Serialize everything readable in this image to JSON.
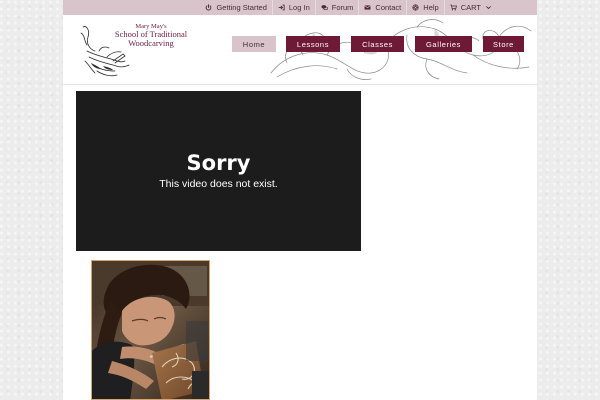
{
  "utility_nav": [
    {
      "label": "Getting Started",
      "icon": "power-icon"
    },
    {
      "label": "Log In",
      "icon": "login-icon"
    },
    {
      "label": "Forum",
      "icon": "chat-icon"
    },
    {
      "label": "Contact",
      "icon": "envelope-icon"
    },
    {
      "label": "Help",
      "icon": "lifebuoy-icon"
    },
    {
      "label": "CART",
      "icon": "cart-icon"
    }
  ],
  "logo": {
    "line1": "Mary May's",
    "line2": "School of Traditional",
    "line3": "Woodcarving"
  },
  "main_nav": [
    {
      "label": "Home",
      "active": true
    },
    {
      "label": "Lessons",
      "active": false
    },
    {
      "label": "Classes",
      "active": false
    },
    {
      "label": "Galleries",
      "active": false
    },
    {
      "label": "Store",
      "active": false
    }
  ],
  "video": {
    "title": "Sorry",
    "message": "This video does not exist."
  },
  "colors": {
    "brand": "#6e1a37",
    "utility_bar": "#d9c4cc",
    "video_bg": "#1c1c1c"
  }
}
